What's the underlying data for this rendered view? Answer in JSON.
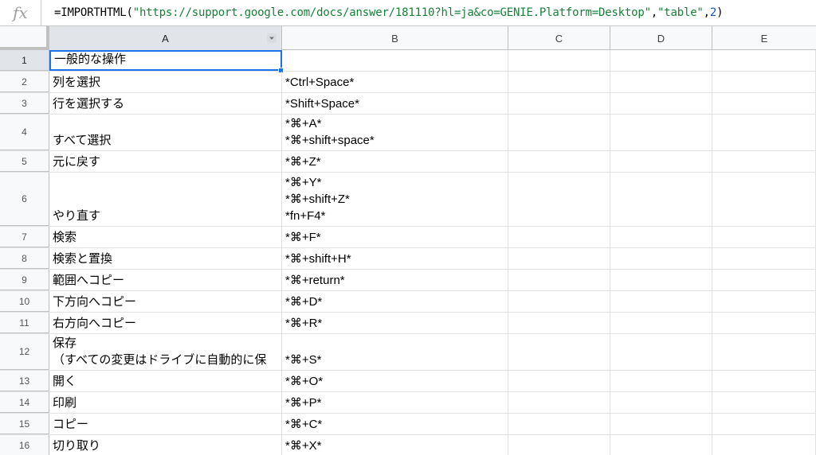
{
  "formula": {
    "fx_label": "fx",
    "prefix": "=IMPORTHTML(",
    "url": "\"https://support.google.com/docs/answer/181110?hl=ja&co=GENIE.Platform=Desktop\"",
    "sep1": ",",
    "arg2": "\"table\"",
    "sep2": ",",
    "arg3": "2",
    "suffix": ")"
  },
  "columns": [
    "A",
    "B",
    "C",
    "D",
    "E"
  ],
  "rows": [
    {
      "num": "1",
      "a": [
        "一般的な操作"
      ],
      "b": []
    },
    {
      "num": "2",
      "a": [
        "列を選択"
      ],
      "b": [
        "*Ctrl+Space*"
      ]
    },
    {
      "num": "3",
      "a": [
        "行を選択する"
      ],
      "b": [
        "*Shift+Space*"
      ]
    },
    {
      "num": "4",
      "a": [
        "すべて選択"
      ],
      "b": [
        "*⌘+A*",
        "*⌘+shift+space*"
      ]
    },
    {
      "num": "5",
      "a": [
        "元に戻す"
      ],
      "b": [
        "*⌘+Z*"
      ]
    },
    {
      "num": "6",
      "a": [
        "やり直す"
      ],
      "b": [
        "*⌘+Y*",
        "*⌘+shift+Z*",
        "*fn+F4*"
      ]
    },
    {
      "num": "7",
      "a": [
        "検索"
      ],
      "b": [
        "*⌘+F*"
      ]
    },
    {
      "num": "8",
      "a": [
        "検索と置換"
      ],
      "b": [
        "*⌘+shift+H*"
      ]
    },
    {
      "num": "9",
      "a": [
        "範囲へコピー"
      ],
      "b": [
        "*⌘+return*"
      ]
    },
    {
      "num": "10",
      "a": [
        "下方向へコピー"
      ],
      "b": [
        "*⌘+D*"
      ]
    },
    {
      "num": "11",
      "a": [
        "右方向へコピー"
      ],
      "b": [
        "*⌘+R*"
      ]
    },
    {
      "num": "12",
      "a": [
        "保存",
        "（すべての変更はドライブに自動的に保"
      ],
      "b": [
        "*⌘+S*"
      ]
    },
    {
      "num": "13",
      "a": [
        "開く"
      ],
      "b": [
        "*⌘+O*"
      ]
    },
    {
      "num": "14",
      "a": [
        "印刷"
      ],
      "b": [
        "*⌘+P*"
      ]
    },
    {
      "num": "15",
      "a": [
        "コピー"
      ],
      "b": [
        "*⌘+C*"
      ]
    },
    {
      "num": "16",
      "a": [
        "切り取り"
      ],
      "b": [
        "*⌘+X*"
      ]
    }
  ],
  "colors": {
    "selection": "#1a73e8",
    "formula_string": "#188038",
    "formula_number": "#1155cc"
  }
}
